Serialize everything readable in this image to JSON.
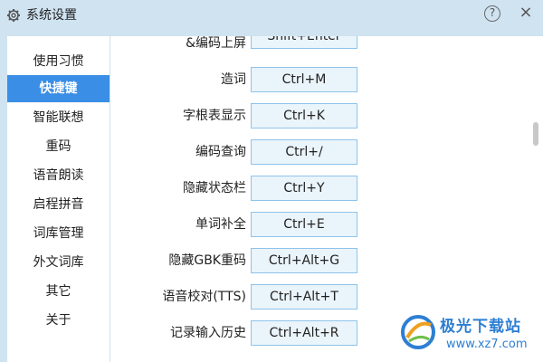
{
  "window": {
    "title": "系统设置",
    "help_symbol": "?",
    "close_symbol": "×"
  },
  "sidebar": {
    "items": [
      {
        "label": "使用习惯",
        "active": false
      },
      {
        "label": "快捷键",
        "active": true
      },
      {
        "label": "智能联想",
        "active": false
      },
      {
        "label": "重码",
        "active": false
      },
      {
        "label": "语音朗读",
        "active": false
      },
      {
        "label": "启程拼音",
        "active": false
      },
      {
        "label": "词库管理",
        "active": false
      },
      {
        "label": "外文词库",
        "active": false
      },
      {
        "label": "其它",
        "active": false
      },
      {
        "label": "关于",
        "active": false
      }
    ]
  },
  "shortcuts": [
    {
      "label": "&编码上屏",
      "key": "Shift+Enter"
    },
    {
      "label": "造词",
      "key": "Ctrl+M"
    },
    {
      "label": "字根表显示",
      "key": "Ctrl+K"
    },
    {
      "label": "编码查询",
      "key": "Ctrl+/"
    },
    {
      "label": "隐藏状态栏",
      "key": "Ctrl+Y"
    },
    {
      "label": "单词补全",
      "key": "Ctrl+E"
    },
    {
      "label": "隐藏GBK重码",
      "key": "Ctrl+Alt+G"
    },
    {
      "label": "语音校对(TTS)",
      "key": "Ctrl+Alt+T"
    },
    {
      "label": "记录输入历史",
      "key": "Ctrl+Alt+R"
    }
  ],
  "watermark": {
    "name": "极光下载站",
    "url": "www.xz7.com"
  },
  "colors": {
    "title_bg": "#cfe3f1",
    "active_bg": "#3a8ee6",
    "key_border": "#8ec3ea",
    "key_bg": "#eaf4fb",
    "watermark": "#2d7fd3"
  }
}
